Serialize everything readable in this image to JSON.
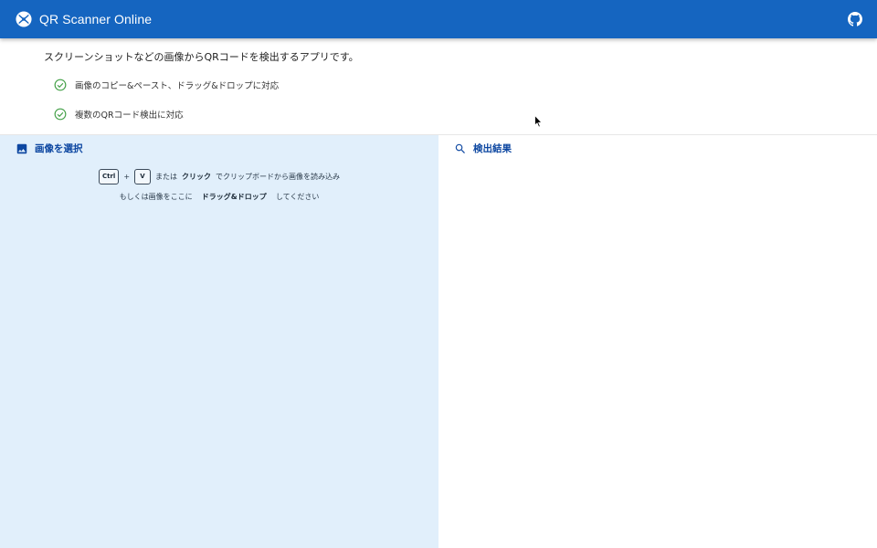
{
  "header": {
    "title": "QR Scanner Online",
    "logo_icon": "qr-scanner-logo-icon",
    "github_icon": "github-icon",
    "background": "#1565c0"
  },
  "intro": {
    "description": "スクリーンショットなどの画像からQRコードを検出するアプリです。",
    "features": [
      {
        "icon": "check-circle-icon",
        "label": "画像のコピー&ペースト、ドラッグ&ドロップに対応"
      },
      {
        "icon": "check-circle-icon",
        "label": "複数のQRコード検出に対応"
      }
    ],
    "check_color": "#43a047"
  },
  "select_pane": {
    "title": "画像を選択",
    "icon": "image-icon",
    "background": "#e1effb",
    "hint": {
      "key_ctrl": "Ctrl",
      "plus": "+",
      "key_v": "V",
      "or_text": "または",
      "click_text": "クリック",
      "clipboard_text": "でクリップボードから画像を読み込み",
      "line2_prefix": "もしくは画像をここに",
      "drag_text": "ドラッグ&ドロップ",
      "line2_suffix": "してください"
    }
  },
  "result_pane": {
    "title": "検出結果",
    "icon": "search-icon"
  }
}
